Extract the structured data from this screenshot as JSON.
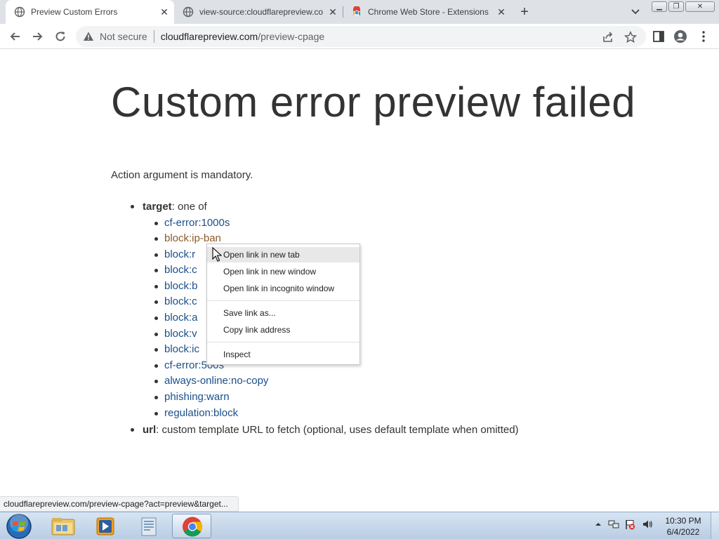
{
  "browser": {
    "tabs": [
      {
        "title": "Preview Custom Errors",
        "icon": "globe-icon",
        "active": true
      },
      {
        "title": "view-source:cloudflarepreview.co",
        "icon": "globe-icon",
        "active": false
      },
      {
        "title": "Chrome Web Store - Extensions",
        "icon": "chrome-web-store-icon",
        "active": false
      }
    ],
    "new_tab_label": "+",
    "address": {
      "security_label": "Not secure",
      "host": "cloudflarepreview.com",
      "path": "/preview-cpage"
    }
  },
  "page": {
    "title": "Custom error preview failed",
    "message": "Action argument is mandatory.",
    "target_label": "target",
    "target_suffix": ": one of",
    "targets": [
      {
        "text": "cf-error:1000s",
        "visited": false
      },
      {
        "text": "block:ip-ban",
        "visited": true
      },
      {
        "text": "block:r",
        "visited": false
      },
      {
        "text": "block:c",
        "visited": false
      },
      {
        "text": "block:b",
        "visited": false
      },
      {
        "text": "block:c",
        "visited": false
      },
      {
        "text": "block:a",
        "visited": false
      },
      {
        "text": "block:v",
        "visited": false
      },
      {
        "text": "block:ic",
        "visited": false
      },
      {
        "text": "cf-error:500s",
        "visited": false
      },
      {
        "text": "always-online:no-copy",
        "visited": false
      },
      {
        "text": "phishing:warn",
        "visited": false
      },
      {
        "text": "regulation:block",
        "visited": false
      }
    ],
    "url_label": "url",
    "url_desc": ": custom template URL to fetch (optional, uses default template when omitted)"
  },
  "context_menu": {
    "items": [
      "Open link in new tab",
      "Open link in new window",
      "Open link in incognito window",
      "Save link as...",
      "Copy link address",
      "Inspect"
    ]
  },
  "status_url": "cloudflarepreview.com/preview-cpage?act=preview&target...",
  "taskbar": {
    "time": "10:30 PM",
    "date": "6/4/2022"
  },
  "colors": {
    "link": "#1a4f8a",
    "visited_link": "#8a5a2b",
    "tabstrip": "#dee1e6"
  }
}
